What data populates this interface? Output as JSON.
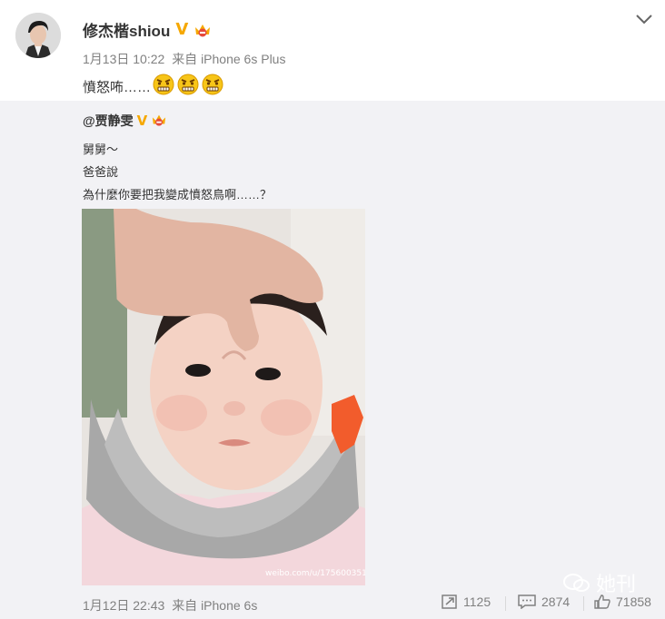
{
  "post": {
    "username": "修杰楷shiou",
    "date": "1月13日 10:22",
    "source": "来自 iPhone 6s Plus",
    "text": "憤怒咘……",
    "emoji_count": 3,
    "emoji_icon": "angry-face-emoji-icon",
    "verified_icon": "verified-v-icon",
    "member_icon": "vip-crown-icon"
  },
  "repost": {
    "username": "@贾静雯",
    "line1": "舅舅～",
    "line2": "爸爸說",
    "line3": "為什麼你要把我變成憤怒鳥啊……？",
    "watermark": "weibo.com/u/1756003513",
    "date": "1月12日 22:43",
    "source": "来自 iPhone 6s",
    "reposts": "1125",
    "comments": "2874",
    "likes": "71858"
  },
  "watermark_logo": "她刊",
  "colors": {
    "accent_gold": "#f6a800",
    "meta_gray": "#808080",
    "repost_bg": "#f2f2f5"
  }
}
